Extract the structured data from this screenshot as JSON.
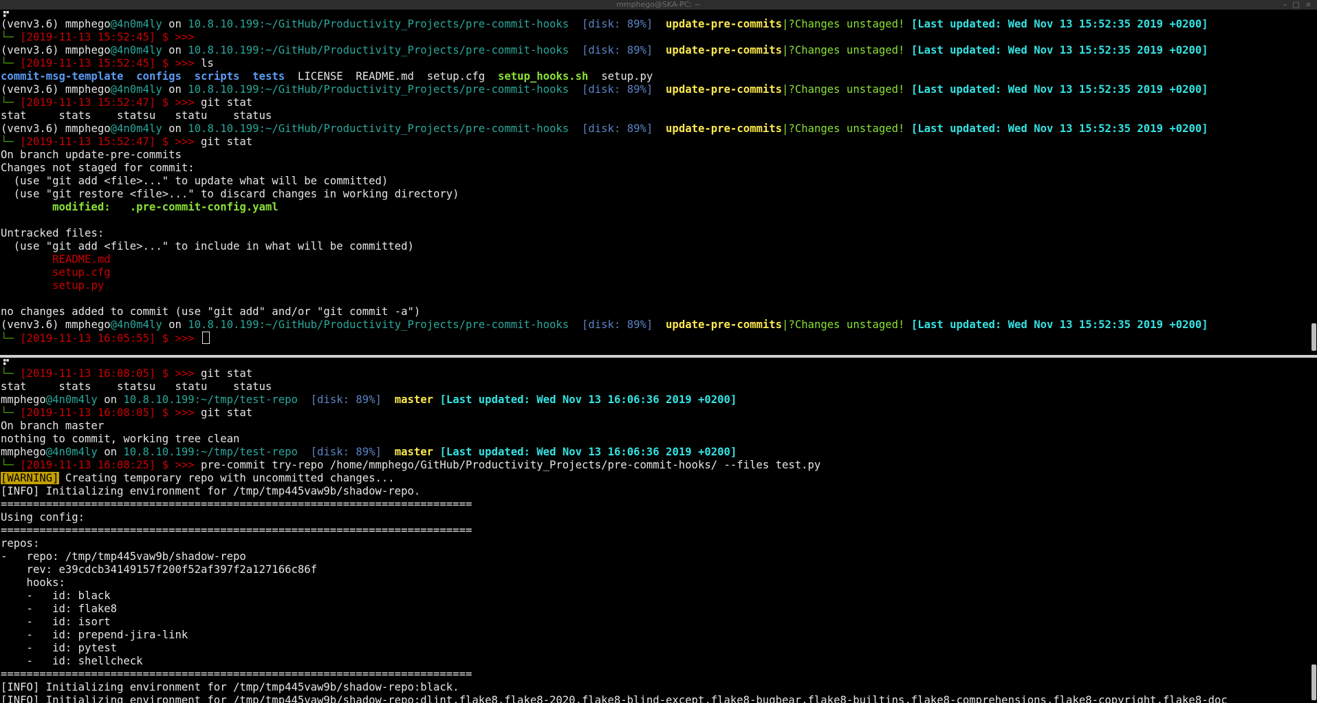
{
  "window": {
    "title": "mmphego@SKA-PC: ~",
    "controls": [
      "–",
      "□",
      "×"
    ]
  },
  "prompt": {
    "venv": "(venv3.6) ",
    "user": "mmphego",
    "at_host": "@4n0m4ly",
    "on": " on ",
    "ip": "10.8.10.199",
    "path_top": ":~/GitHub/Productivity_Projects/pre-commit-hooks",
    "path_bottom": ":~/tmp/test-repo",
    "disk": "[disk: 89%]",
    "branch_top": "update-pre-commits",
    "branch_bottom": "master",
    "status_top": "|?Changes unstaged!",
    "updated_top": "[Last updated: Wed Nov 13 15:52:35 2019 +0200]",
    "updated_bottom": "[Last updated: Wed Nov 13 16:06:36 2019 +0200]",
    "corner": "└─",
    "arrow": " $ >>> "
  },
  "top_pane": {
    "ts1": "[2019-11-13 15:52:45]",
    "ts2": "[2019-11-13 15:52:45]",
    "cmd_ls": "ls",
    "ls_dirs": [
      "commit-msg-template",
      "configs",
      "scripts",
      "tests"
    ],
    "ls_files1": [
      "LICENSE",
      "README.md",
      "setup.cfg"
    ],
    "ls_exec": "setup_hooks.sh",
    "ls_files2": "setup.py",
    "ts3": "[2019-11-13 15:52:47]",
    "cmd_gitstat": "git stat",
    "completions": "stat     stats    statsu   statu    status",
    "ts4": "[2019-11-13 15:52:47]",
    "on_branch": "On branch update-pre-commits",
    "not_staged": "Changes not staged for commit:",
    "hint_add": "  (use \"git add <file>...\" to update what will be committed)",
    "hint_restore": "  (use \"git restore <file>...\" to discard changes in working directory)",
    "modified_label": "        modified:   .pre-commit-config.yaml",
    "untracked": "Untracked files:",
    "hint_include": "  (use \"git add <file>...\" to include in what will be committed)",
    "untracked_files": [
      "README.md",
      "setup.cfg",
      "setup.py"
    ],
    "no_changes": "no changes added to commit (use \"git add\" and/or \"git commit -a\")",
    "ts5": "[2019-11-13 16:05:55]"
  },
  "bottom_pane": {
    "ts1": "[2019-11-13 16:08:05]",
    "cmd_gitstat": "git stat",
    "completions": "stat     stats    statsu   statu    status",
    "ts2": "[2019-11-13 16:08:05]",
    "on_branch": "On branch master",
    "clean": "nothing to commit, working tree clean",
    "ts3": "[2019-11-13 16:08:25]",
    "cmd_precommit": "pre-commit try-repo /home/mmphego/GitHub/Productivity_Projects/pre-commit-hooks/ --files test.py",
    "warn_tag": "[WARNING]",
    "warn_msg": " Creating temporary repo with uncommitted changes...",
    "info1": "[INFO] Initializing environment for /tmp/tmp445vaw9b/shadow-repo.",
    "sep": "=========================================================================",
    "using_config": "Using config:",
    "repos": "repos:",
    "repo_line": "-   repo: /tmp/tmp445vaw9b/shadow-repo",
    "rev_line": "    rev: e39cdcb34149157f200f52af397f2a127166c86f",
    "hooks_line": "    hooks:",
    "hook_ids": [
      "black",
      "flake8",
      "isort",
      "prepend-jira-link",
      "pytest",
      "shellcheck"
    ],
    "info2": "[INFO] Initializing environment for /tmp/tmp445vaw9b/shadow-repo:black.",
    "info3": "[INFO] Initializing environment for /tmp/tmp445vaw9b/shadow-repo:dlint,flake8,flake8-2020,flake8-blind-except,flake8-bugbear,flake8-builtins,flake8-comprehensions,flake8-copyright,flake8-doc"
  }
}
